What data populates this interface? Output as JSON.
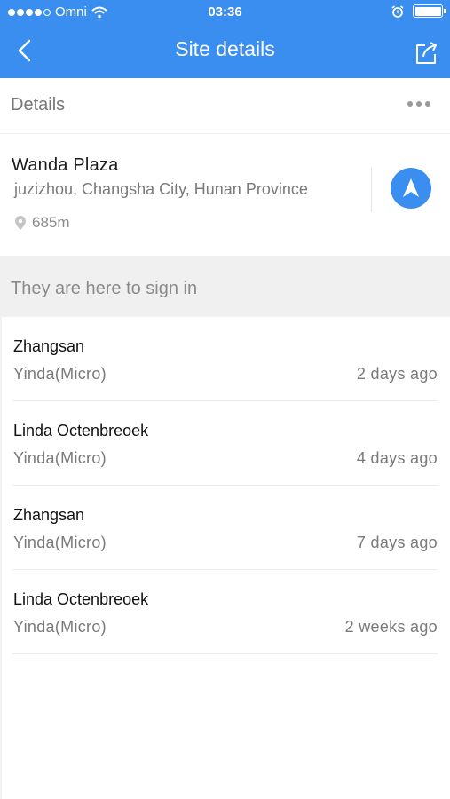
{
  "status_bar": {
    "carrier": "Omni",
    "time": "03:36",
    "signal_bars_filled": 4,
    "signal_bars_total": 5,
    "battery_level": 1.0
  },
  "nav": {
    "title": "Site details",
    "back_icon": "chevron-left-icon",
    "share_icon": "share-icon"
  },
  "details_bar": {
    "label": "Details",
    "more_icon": "more-horizontal-icon"
  },
  "site": {
    "name": "Wanda Plaza",
    "address": "juzizhou, Changsha City, Hunan Province",
    "distance": "685m",
    "navigate_icon": "navigation-arrow-icon"
  },
  "signin_section": {
    "title": "They are here to sign in"
  },
  "signins": [
    {
      "name": "Zhangsan",
      "org": "Yinda(Micro)",
      "time": "2 days ago"
    },
    {
      "name": "Linda Octenbreoek",
      "org": "Yinda(Micro)",
      "time": "4 days ago"
    },
    {
      "name": "Zhangsan",
      "org": "Yinda(Micro)",
      "time": "7 days ago"
    },
    {
      "name": "Linda Octenbreoek",
      "org": "Yinda(Micro)",
      "time": "2 weeks ago"
    }
  ],
  "colors": {
    "accent": "#3a8ef0",
    "section_bg": "#f0f0f0",
    "muted_text": "#7a7a7a"
  }
}
